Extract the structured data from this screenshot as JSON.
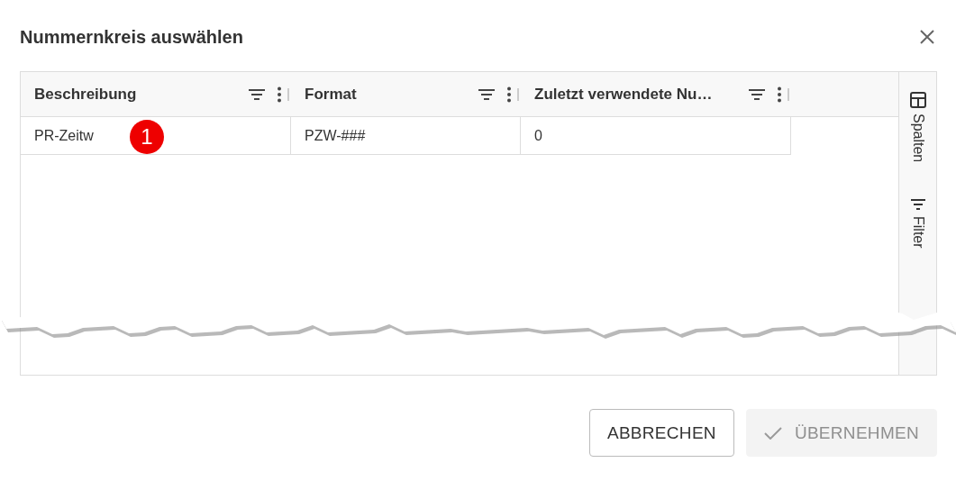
{
  "dialog": {
    "title": "Nummernkreis auswählen"
  },
  "table": {
    "columns": [
      {
        "label": "Beschreibung"
      },
      {
        "label": "Format"
      },
      {
        "label": "Zuletzt verwendete Nu…"
      }
    ],
    "rows": [
      {
        "cells": [
          "PR-Zeitw",
          "PZW-###",
          "0"
        ]
      }
    ]
  },
  "side_panel": [
    {
      "label": "Spalten",
      "kind": "columns"
    },
    {
      "label": "Filter",
      "kind": "filter"
    }
  ],
  "callout": {
    "label": "1"
  },
  "buttons": [
    {
      "label": "ABBRECHEN",
      "disabled": false,
      "kind": "cancel"
    },
    {
      "label": "ÜBERNEHMEN",
      "disabled": true,
      "kind": "apply"
    }
  ]
}
